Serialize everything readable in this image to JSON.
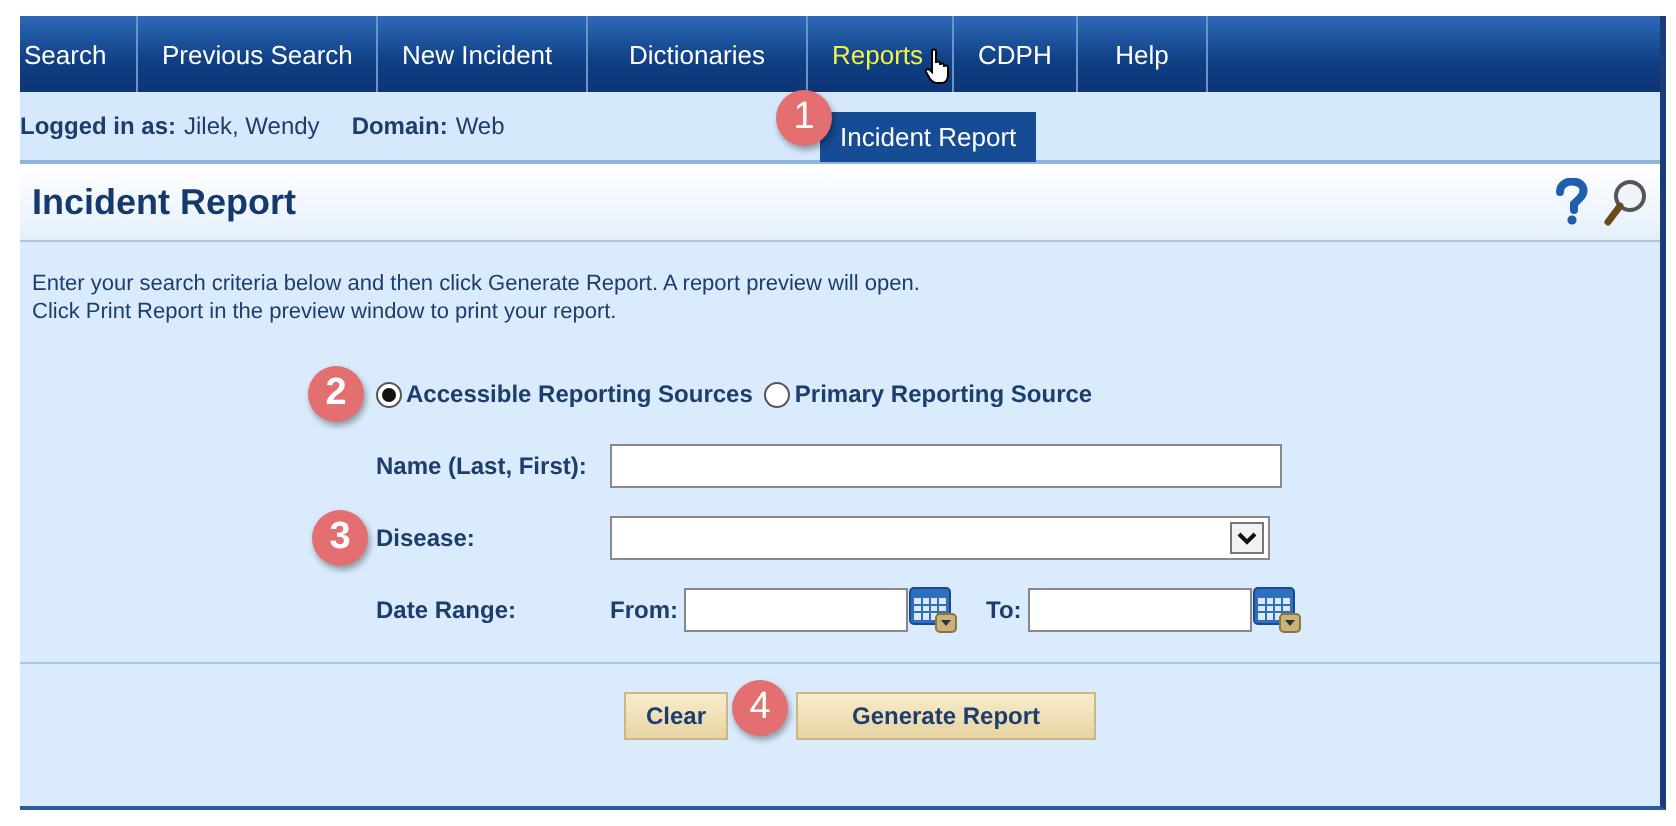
{
  "nav": {
    "items": [
      {
        "label": "Search",
        "selected": false
      },
      {
        "label": "Previous Search",
        "selected": false
      },
      {
        "label": "New Incident",
        "selected": false
      },
      {
        "label": "Dictionaries",
        "selected": false
      },
      {
        "label": "Reports",
        "selected": true
      },
      {
        "label": "CDPH",
        "selected": false
      },
      {
        "label": "Help",
        "selected": false
      }
    ],
    "dropdown": {
      "items": [
        "Incident Report"
      ],
      "callout": "1"
    }
  },
  "login": {
    "label": "Logged in as:",
    "user": "Jilek, Wendy",
    "domain_label": "Domain:",
    "domain": "Web"
  },
  "title": "Incident Report",
  "instructions": [
    "Enter your search criteria below and then click Generate Report. A report preview will open.",
    "Click Print Report in the preview window to print your report."
  ],
  "source": {
    "callout": "2",
    "options": [
      {
        "label": "Accessible Reporting Sources",
        "selected": true
      },
      {
        "label": "Primary Reporting Source",
        "selected": false
      }
    ]
  },
  "name_field": {
    "label": "Name (Last, First):"
  },
  "disease_field": {
    "label": "Disease:",
    "callout": "3"
  },
  "date_range": {
    "label": "Date Range:",
    "from_label": "From:",
    "to_label": "To:"
  },
  "buttons": [
    {
      "label": "Clear"
    },
    {
      "label": "Generate Report",
      "callout": "4"
    }
  ]
}
